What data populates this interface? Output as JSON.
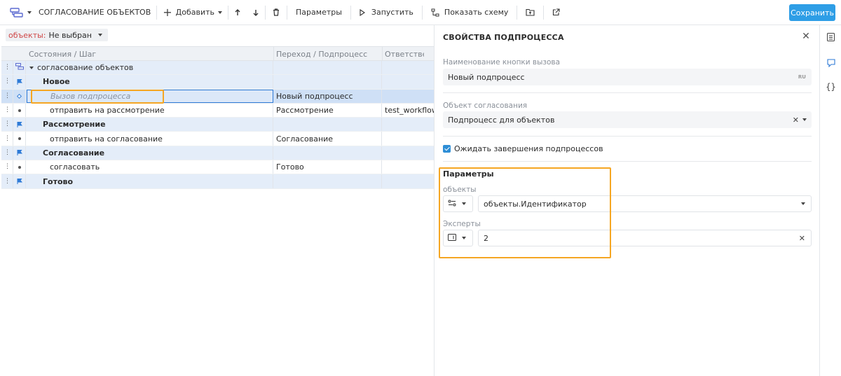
{
  "toolbar": {
    "title": "СОГЛАСОВАНИЕ ОБЪЕКТОВ",
    "add_label": "Добавить",
    "params_label": "Параметры",
    "run_label": "Запустить",
    "show_schema_label": "Показать схему",
    "save_label": "Сохранить"
  },
  "filter": {
    "label": "объекты:",
    "value": "Не выбран"
  },
  "grid": {
    "columns": [
      "Состояния / Шаг",
      "Переход / Подпроцесс",
      "Ответственный"
    ],
    "rows": [
      {
        "kind": "root",
        "name": "согласование объектов",
        "transition": "",
        "responsible": ""
      },
      {
        "kind": "state",
        "name": "Новое",
        "transition": "",
        "responsible": ""
      },
      {
        "kind": "subprocess",
        "name": "Вызов подпроцесса",
        "transition": "Новый подпроцесс",
        "responsible": ""
      },
      {
        "kind": "step",
        "name": "отправить на рассмотрение",
        "transition": "Рассмотрение",
        "responsible": "test_workflow"
      },
      {
        "kind": "state",
        "name": "Рассмотрение",
        "transition": "",
        "responsible": ""
      },
      {
        "kind": "step",
        "name": "отправить на согласование",
        "transition": "Согласование",
        "responsible": ""
      },
      {
        "kind": "state",
        "name": "Согласование",
        "transition": "",
        "responsible": ""
      },
      {
        "kind": "step",
        "name": "согласовать",
        "transition": "Готово",
        "responsible": ""
      },
      {
        "kind": "state",
        "name": "Готово",
        "transition": "",
        "responsible": ""
      }
    ]
  },
  "panel": {
    "title": "СВОЙСТВА ПОДПРОЦЕССА",
    "button_name_label": "Наименование кнопки вызова",
    "button_name_value": "Новый подпроцесс",
    "lang_badge": "RU",
    "object_label": "Объект согласования",
    "object_value": "Подпроцесс для объектов",
    "wait_label": "Ожидать завершения подпроцессов",
    "wait_checked": true,
    "params_title": "Параметры",
    "param1_label": "объекты",
    "param1_value": "объекты.Идентификатор",
    "param2_label": "Эксперты",
    "param2_value": "2"
  },
  "colors": {
    "accent": "#2e9ee6",
    "highlight": "#f5a623",
    "state_row": "#e4edf9",
    "selected_row": "#cfe0f6"
  }
}
